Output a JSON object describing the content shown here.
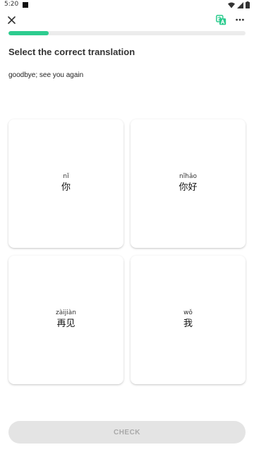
{
  "status_bar": {
    "time": "5:20",
    "icons": [
      "wifi-icon",
      "cell-signal-icon",
      "battery-icon"
    ]
  },
  "toolbar": {
    "close_icon": "close-icon",
    "translate_icon": "translate-icon",
    "more_icon": "more-horizontal-icon"
  },
  "lesson": {
    "progress": 0.17,
    "progress_color": "#2dcc8f",
    "title": "Select the correct translation",
    "prompt": "goodbye; see you again"
  },
  "options": [
    {
      "pinyin": "nǐ",
      "hanzi": "你"
    },
    {
      "pinyin": "nǐhǎo",
      "hanzi": "你好"
    },
    {
      "pinyin": "zàijiàn",
      "hanzi": "再见"
    },
    {
      "pinyin": "wǒ",
      "hanzi": "我"
    }
  ],
  "footer": {
    "check_label": "CHECK"
  }
}
